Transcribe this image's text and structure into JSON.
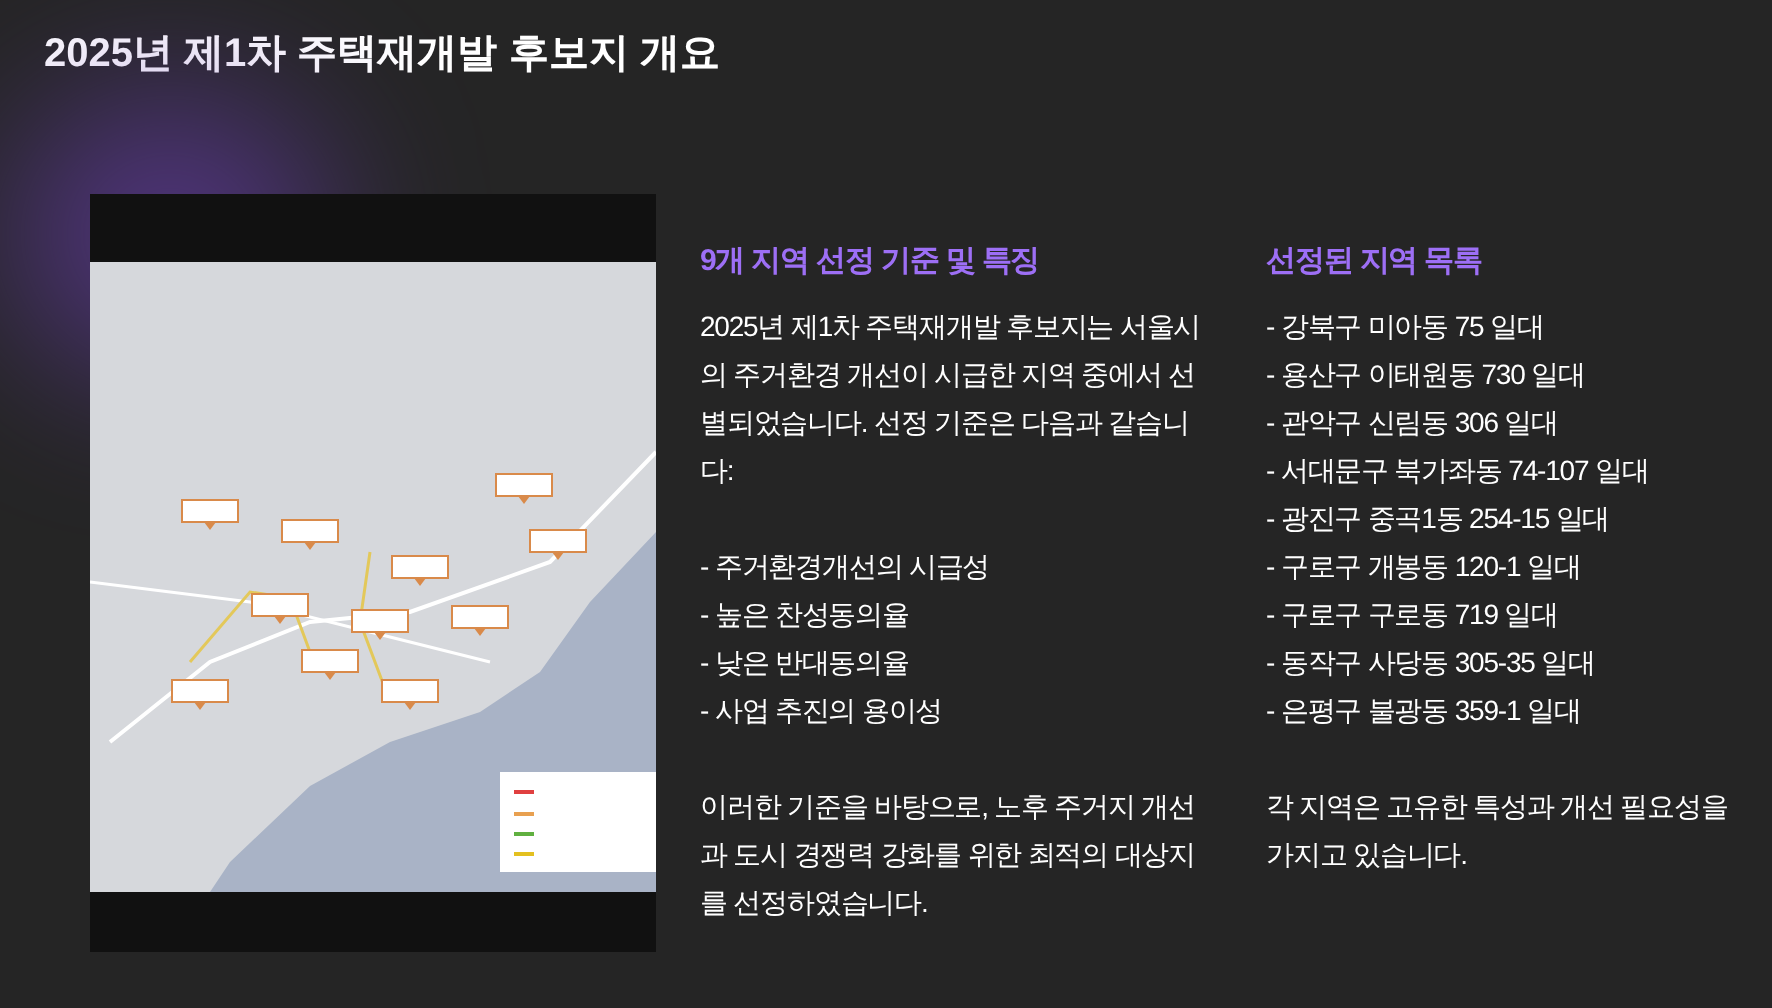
{
  "title": "2025년 제1차 주택재개발 후보지 개요",
  "criteria": {
    "heading": "9개 지역 선정 기준 및 특징",
    "intro": "2025년 제1차 주택재개발 후보지는 서울시의 주거환경 개선이 시급한 지역 중에서 선별되었습니다. 선정 기준은 다음과 같습니다:",
    "items": [
      "- 주거환경개선의 시급성",
      "- 높은 찬성동의율",
      "- 낮은 반대동의율",
      "- 사업 추진의 용이성"
    ],
    "conclusion": "이러한 기준을 바탕으로, 노후 주거지 개선과 도시 경쟁력 강화를 위한 최적의 대상지를 선정하였습니다."
  },
  "areas": {
    "heading": "선정된 지역 목록",
    "items": [
      "- 강북구 미아동 75 일대",
      "- 용산구 이태원동 730 일대",
      "- 관악구 신림동 306 일대",
      "- 서대문구 북가좌동 74-107 일대",
      "- 광진구 중곡1동 254-15 일대",
      "- 구로구 개봉동 120-1 일대",
      "- 구로구 구로동 719 일대",
      "- 동작구 사당동 305-35 일대",
      "- 은평구 불광동 359-1 일대"
    ],
    "conclusion": "각 지역은 고유한 특성과 개선 필요성을 가지고 있습니다."
  }
}
